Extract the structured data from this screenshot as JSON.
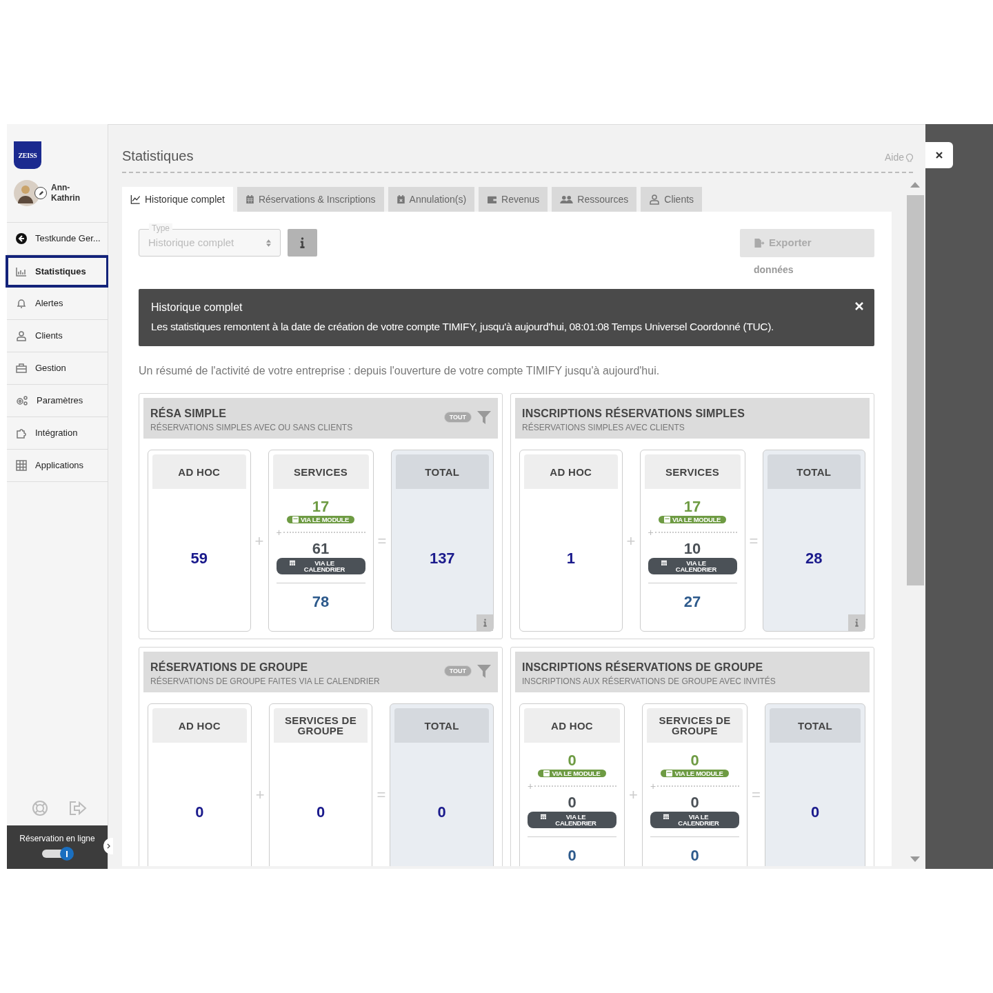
{
  "sidebar": {
    "logo": "ZEISS",
    "user": {
      "name": "Ann-Kathrin"
    },
    "items": [
      {
        "label": "Testkunde Ger...",
        "kind": "back",
        "selected": false
      },
      {
        "label": "Statistiques",
        "kind": "stats",
        "selected": true
      },
      {
        "label": "Alertes",
        "kind": "bell",
        "selected": false
      },
      {
        "label": "Clients",
        "kind": "user",
        "selected": false
      },
      {
        "label": "Gestion",
        "kind": "toolbox",
        "selected": false
      },
      {
        "label": "Paramètres",
        "kind": "gears",
        "selected": false
      },
      {
        "label": "Intégration",
        "kind": "puzzle",
        "selected": false
      },
      {
        "label": "Applications",
        "kind": "grid",
        "selected": false
      }
    ],
    "online_booking": {
      "label": "Réservation en ligne",
      "on": true
    }
  },
  "page": {
    "title": "Statistiques",
    "help": "Aide"
  },
  "tabs": [
    {
      "label": "Historique complet",
      "kind": "chart",
      "selected": true
    },
    {
      "label": "Réservations & Inscriptions",
      "kind": "calendar",
      "selected": false
    },
    {
      "label": "Annulation(s)",
      "kind": "cancel",
      "selected": false
    },
    {
      "label": "Revenus",
      "kind": "wallet",
      "selected": false
    },
    {
      "label": "Ressources",
      "kind": "users",
      "selected": false
    },
    {
      "label": "Clients",
      "kind": "user",
      "selected": false
    }
  ],
  "type_select": {
    "label": "Type",
    "value": "Historique complet",
    "disabled": true
  },
  "export_button": {
    "label": "Exporter",
    "sublabel": "données",
    "disabled": true
  },
  "banner": {
    "title": "Historique complet",
    "text": "Les statistiques remontent à la date de création de votre compte TIMIFY, jusqu'à aujourd'hui, 08:01:08 Temps Universel Coordonné (TUC)."
  },
  "summary": "Un résumé de l'activité de votre entreprise : depuis l'ouverture de votre compte TIMIFY jusqu'à aujourd'hui.",
  "cards": [
    {
      "title": "RÉSA SIMPLE",
      "subtitle": "RÉSERVATIONS SIMPLES AVEC OU SANS CLIENTS",
      "filter_badge": "TOUT",
      "operators": [
        "+",
        "="
      ],
      "columns": [
        {
          "header": "AD HOC",
          "kind": "single",
          "value": "59"
        },
        {
          "header": "SERVICES",
          "kind": "split",
          "module": {
            "value": "17",
            "label": "VIA LE MODULE"
          },
          "separator": "+",
          "calendar": {
            "value": "61",
            "label": "VIA LE CALENDRIER"
          },
          "sum": "78"
        },
        {
          "header": "TOTAL",
          "kind": "total",
          "value": "137",
          "info": true
        }
      ]
    },
    {
      "title": "INSCRIPTIONS RÉSERVATIONS SIMPLES",
      "subtitle": "RÉSERVATIONS SIMPLES AVEC CLIENTS",
      "operators": [
        "+",
        "="
      ],
      "columns": [
        {
          "header": "AD HOC",
          "kind": "single",
          "value": "1"
        },
        {
          "header": "SERVICES",
          "kind": "split",
          "module": {
            "value": "17",
            "label": "VIA LE MODULE"
          },
          "separator": "+",
          "calendar": {
            "value": "10",
            "label": "VIA LE CALENDRIER"
          },
          "sum": "27"
        },
        {
          "header": "TOTAL",
          "kind": "total",
          "value": "28",
          "info": true
        }
      ]
    },
    {
      "title": "RÉSERVATIONS DE GROUPE",
      "subtitle": "RÉSERVATIONS DE GROUPE FAITES VIA LE CALENDRIER",
      "filter_badge": "TOUT",
      "operators": [
        "+",
        "="
      ],
      "columns": [
        {
          "header": "AD HOC",
          "kind": "single",
          "value": "0"
        },
        {
          "header": "SERVICES DE GROUPE",
          "kind": "single",
          "value": "0"
        },
        {
          "header": "TOTAL",
          "kind": "total",
          "value": "0"
        }
      ]
    },
    {
      "title": "INSCRIPTIONS RÉSERVATIONS DE GROUPE",
      "subtitle": "INSCRIPTIONS AUX RÉSERVATIONS DE GROUPE AVEC INVITÉS",
      "operators": [
        "+",
        "="
      ],
      "columns": [
        {
          "header": "AD HOC",
          "kind": "split",
          "module": {
            "value": "0",
            "label": "VIA LE MODULE"
          },
          "separator": "+",
          "calendar": {
            "value": "0",
            "label": "VIA LE CALENDRIER"
          },
          "sum": "0"
        },
        {
          "header": "SERVICES DE GROUPE",
          "kind": "split",
          "module": {
            "value": "0",
            "label": "VIA LE MODULE"
          },
          "separator": "+",
          "calendar": {
            "value": "0",
            "label": "VIA LE CALENDRIER"
          },
          "sum": "0"
        },
        {
          "header": "TOTAL",
          "kind": "total",
          "value": "0"
        }
      ]
    }
  ]
}
